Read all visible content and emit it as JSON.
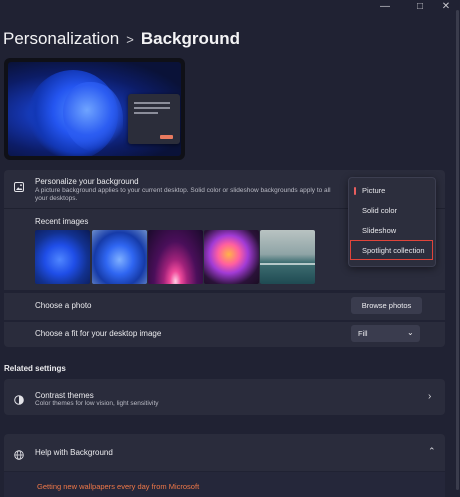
{
  "window": {
    "minimize_icon": "—",
    "maximize_icon": "□",
    "close_icon": "✕"
  },
  "breadcrumb": {
    "parent": "Personalization",
    "separator": ">",
    "current": "Background"
  },
  "background_section": {
    "title": "Personalize your background",
    "description_line1": "A picture background applies to your current desktop. Solid color or slideshow backgrounds apply to all",
    "description_line2": "your desktops.",
    "recent_images_label": "Recent images",
    "recent_images": [
      "Windows 11 bloom (dark)",
      "Windows 11 bloom (light)",
      "Glow",
      "Flower",
      "Lake"
    ]
  },
  "dropdown": {
    "options": [
      "Picture",
      "Solid color",
      "Slideshow",
      "Spotlight collection"
    ],
    "selected_index": 0,
    "highlighted_index": 3
  },
  "choose_photo": {
    "label": "Choose a photo",
    "button": "Browse photos"
  },
  "choose_fit": {
    "label": "Choose a fit for your desktop image",
    "value": "Fill"
  },
  "related": {
    "heading": "Related settings",
    "contrast_title": "Contrast themes",
    "contrast_desc": "Color themes for low vision, light sensitivity"
  },
  "help": {
    "title": "Help with Background",
    "link": "Getting new wallpapers every day from Microsoft"
  },
  "colors": {
    "accent": "#e85e5e",
    "link": "#f07848",
    "highlight_box": "#e0443a"
  }
}
